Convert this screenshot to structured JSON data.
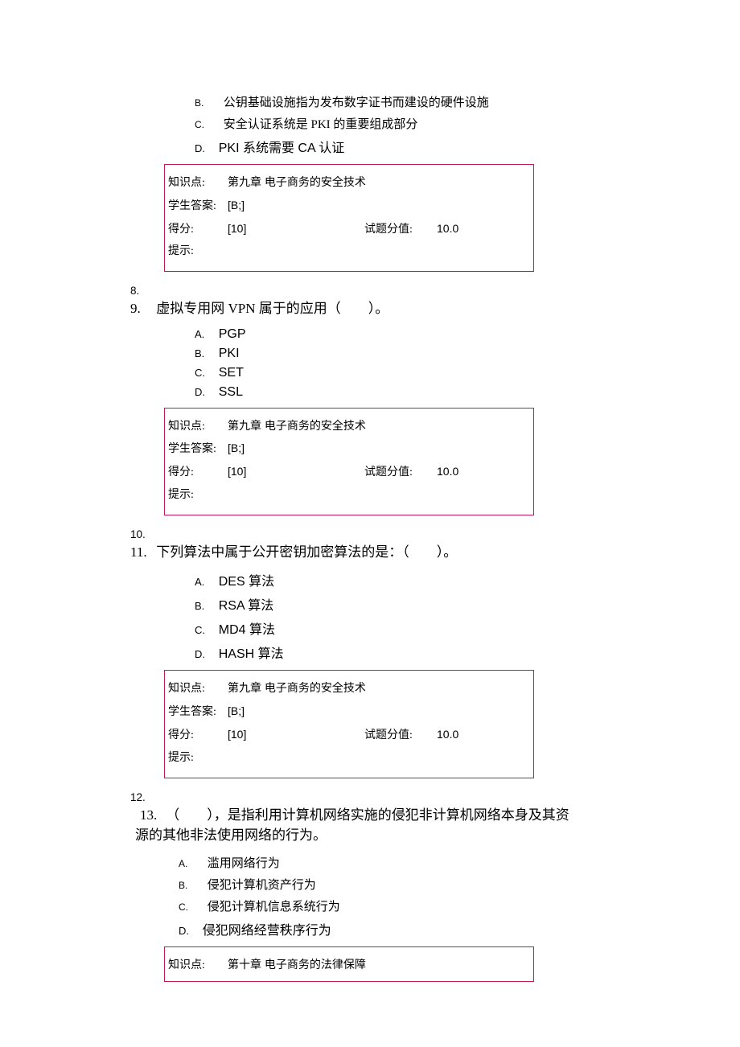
{
  "q7_tail": {
    "options": [
      {
        "letter": "B.",
        "text": "公钥基础设施指为发布数字证书而建设的硬件设施"
      },
      {
        "letter": "C.",
        "text": "安全认证系统是 PKI 的重要组成部分"
      },
      {
        "letter": "D.",
        "text": "PKI 系统需要 CA 认证"
      }
    ],
    "info": {
      "kp_label": "知识点:",
      "kp_value": "第九章 电子商务的安全技术",
      "ans_label": "学生答案:",
      "ans_value": "[B;]",
      "score_label": "得分:",
      "score_value": "[10]",
      "pv_label": "试题分值:",
      "pv_value": "10.0",
      "hint_label": "提示:"
    }
  },
  "q8_num": "8.",
  "q9": {
    "num": "9.",
    "stem": "虚拟专用网 VPN 属于的应用（　　）。",
    "options": [
      {
        "letter": "A.",
        "text": "PGP"
      },
      {
        "letter": "B.",
        "text": "PKI"
      },
      {
        "letter": "C.",
        "text": "SET"
      },
      {
        "letter": "D.",
        "text": "SSL"
      }
    ],
    "info": {
      "kp_label": "知识点:",
      "kp_value": "第九章 电子商务的安全技术",
      "ans_label": "学生答案:",
      "ans_value": "[B;]",
      "score_label": "得分:",
      "score_value": "[10]",
      "pv_label": "试题分值:",
      "pv_value": "10.0",
      "hint_label": "提示:"
    }
  },
  "q10_num": "10.",
  "q11": {
    "num": "11.",
    "stem": "下列算法中属于公开密钥加密算法的是：（　　）。",
    "options": [
      {
        "letter": "A.",
        "text": "DES 算法"
      },
      {
        "letter": "B.",
        "text": "RSA 算法"
      },
      {
        "letter": "C.",
        "text": "MD4 算法"
      },
      {
        "letter": "D.",
        "text": "HASH 算法"
      }
    ],
    "info": {
      "kp_label": "知识点:",
      "kp_value": "第九章 电子商务的安全技术",
      "ans_label": "学生答案:",
      "ans_value": "[B;]",
      "score_label": "得分:",
      "score_value": "[10]",
      "pv_label": "试题分值:",
      "pv_value": "10.0",
      "hint_label": "提示:"
    }
  },
  "q12_num": "12.",
  "q13": {
    "num": "13.",
    "stem_line1": "（　　），是指利用计算机网络实施的侵犯非计算机网络本身及其资",
    "stem_line2": "源的其他非法使用网络的行为。",
    "options": [
      {
        "letter": "A.",
        "text": "滥用网络行为"
      },
      {
        "letter": "B.",
        "text": "侵犯计算机资产行为"
      },
      {
        "letter": "C.",
        "text": "侵犯计算机信息系统行为"
      },
      {
        "letter": "D.",
        "text": "侵犯网络经营秩序行为"
      }
    ],
    "info": {
      "kp_label": "知识点:",
      "kp_value": "第十章 电子商务的法律保障"
    }
  }
}
